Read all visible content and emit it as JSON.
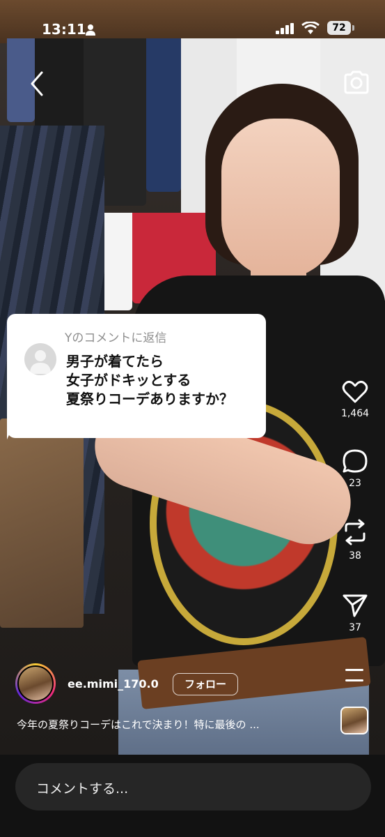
{
  "status_bar": {
    "time": "13:11",
    "battery": "72"
  },
  "reply_sticker": {
    "title": "Yのコメントに返信",
    "line1": "男子が着てたら",
    "line2": "女子がドキッとする",
    "line3": "夏祭りコーデありますか？"
  },
  "actions": {
    "likes": "1,464",
    "comments": "23",
    "reposts": "38",
    "shares": "37"
  },
  "author": {
    "username": "ee.mimi_170.0",
    "follow_label": "フォロー"
  },
  "caption": "今年の夏祭りコーデはこれで決まり！特に最後の ...",
  "comment_placeholder": "コメントする..."
}
